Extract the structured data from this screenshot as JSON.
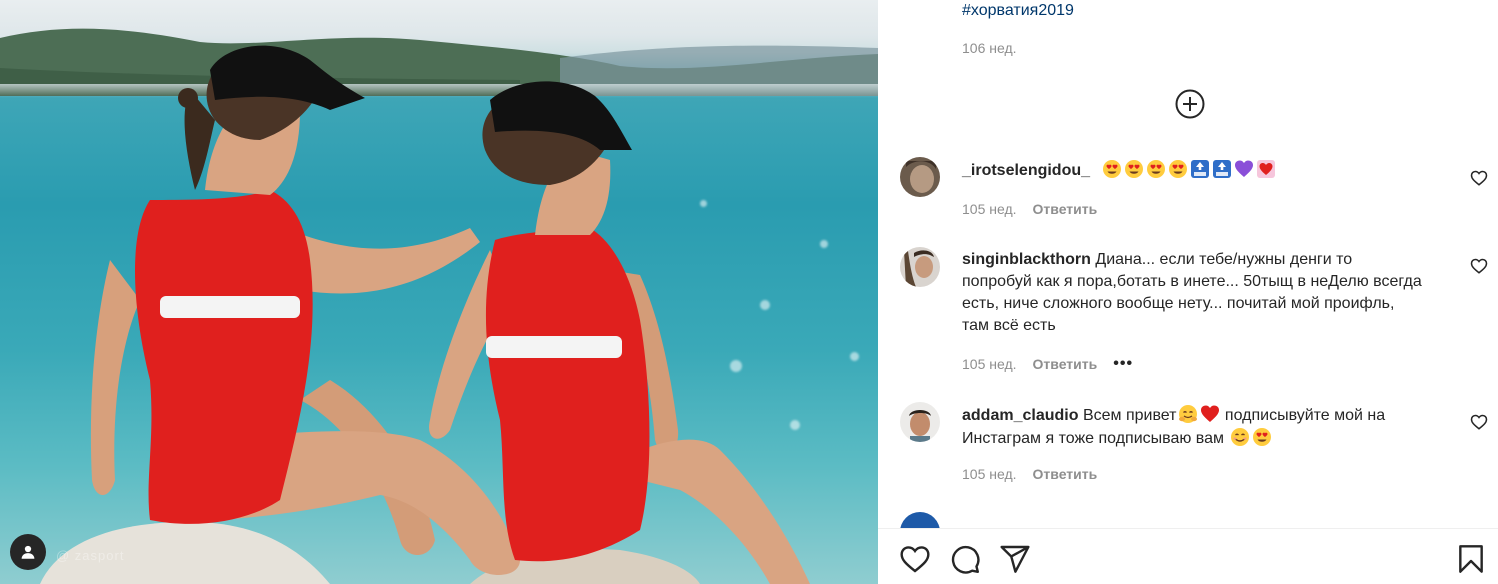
{
  "post": {
    "hashtag": "#хорватия2019",
    "time": "106 нед."
  },
  "comments": [
    {
      "username": "_irotselengidou_",
      "text": "",
      "emojis": [
        "heart-eyes-emoji",
        "heart-eyes-emoji",
        "heart-eyes-emoji",
        "heart-eyes-emoji",
        "top-arrow-emoji",
        "top-arrow-emoji",
        "purple-heart-emoji",
        "heart-decoration-emoji"
      ],
      "time": "105 нед.",
      "reply": "Ответить",
      "has_more": false
    },
    {
      "username": "singinblackthorn",
      "text": "Диана... если тебе/нужны денги то попробуй как я пора,ботать в инете... 50тыщ в неДелю всегда есть, ниче сложного вообще нету... почитай мой проифль, там всё есть",
      "emojis": [],
      "time": "105 нед.",
      "reply": "Ответить",
      "has_more": true,
      "more": "•••"
    },
    {
      "username": "addam_claudio",
      "text_before": "Всем привет",
      "text_after": " подписывуйте мой на Инстаграм я тоже подписываю вам ",
      "emojis_mid": [
        "hug-emoji",
        "red-heart-emoji"
      ],
      "emojis_end": [
        "smile-emoji",
        "heart-eyes-emoji"
      ],
      "time": "105 нед.",
      "reply": "Ответить",
      "has_more": false
    }
  ],
  "photo": {
    "watermark": "@ zasport"
  },
  "icons": {
    "load_more": "plus-circle-icon",
    "like": "heart-outline-icon",
    "comment": "comment-bubble-icon",
    "share": "paper-plane-icon",
    "save": "bookmark-icon",
    "user_tag": "user-tag-icon"
  },
  "colors": {
    "link": "#00376b",
    "muted": "#8e8e8e",
    "text": "#262626",
    "swimsuit": "#e0201e"
  }
}
